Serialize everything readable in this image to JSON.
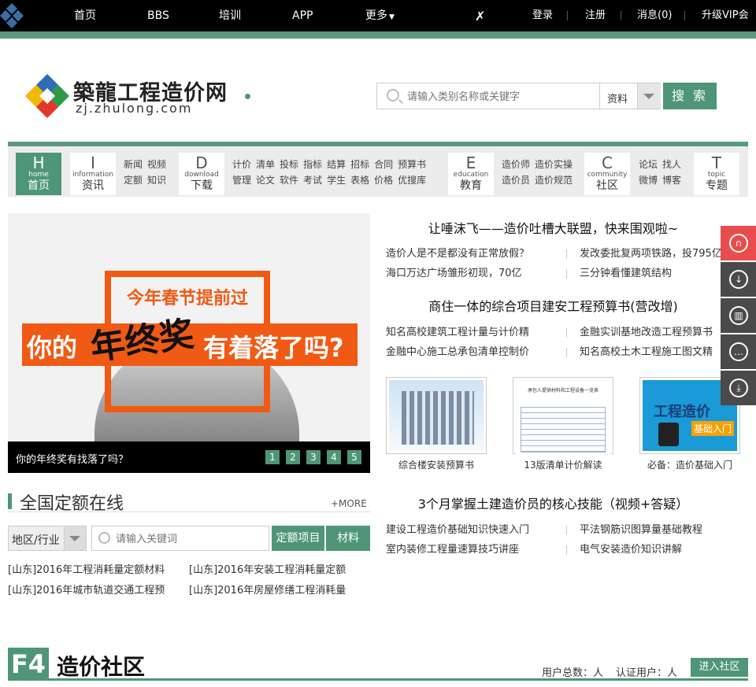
{
  "topnav": {
    "items": [
      "首页",
      "BBS",
      "培训",
      "APP",
      "更多"
    ],
    "right": [
      "登录",
      "注册",
      "消息(0)",
      "升级VIP会员"
    ]
  },
  "header": {
    "logo_cn": "築龍工程造价网",
    "logo_en": "zj.zhulong.com",
    "search_placeholder": "请输入类别名称或关键字",
    "search_type": "资料",
    "search_button": "搜 索"
  },
  "catnav": {
    "home": {
      "letter": "H",
      "en": "home",
      "zh": "首页"
    },
    "info": {
      "letter": "I",
      "en": "information",
      "zh": "资讯",
      "links": [
        [
          "新闻",
          "视频"
        ],
        [
          "定额",
          "知识"
        ]
      ]
    },
    "download": {
      "letter": "D",
      "en": "download",
      "zh": "下载",
      "links": [
        [
          "计价",
          "清单",
          "投标",
          "指标",
          "结算",
          "招标",
          "合同",
          "预算书"
        ],
        [
          "管理",
          "论文",
          "软件",
          "考试",
          "学生",
          "表格",
          "价格",
          "优搜库"
        ]
      ]
    },
    "education": {
      "letter": "E",
      "en": "education",
      "zh": "教育",
      "links": [
        [
          "造价师",
          "造价实操"
        ],
        [
          "造价员",
          "造价规范"
        ]
      ]
    },
    "community": {
      "letter": "C",
      "en": "community",
      "zh": "社区",
      "links": [
        [
          "论坛",
          "找人"
        ],
        [
          "微博",
          "博客"
        ]
      ]
    },
    "topic": {
      "letter": "T",
      "en": "topic",
      "zh": "专题"
    }
  },
  "slider": {
    "banner_top": "今年春节提前过",
    "banner_main_1": "你的",
    "banner_main_2": "年终奖",
    "banner_main_3": "有着落了吗?",
    "caption": "你的年终奖有找落了吗？",
    "pages": [
      "1",
      "2",
      "3",
      "4",
      "5"
    ]
  },
  "news": {
    "head1": "让唾沫飞——造价吐槽大联盟，快来围观啦~",
    "list1": [
      "造价人是不是都没有正常放假？",
      "发改委批复两项铁路，投795亿",
      "海口万达广场雏形初现，70亿",
      "三分钟看懂建筑结构"
    ],
    "head2": "商住一体的综合项目建安工程预算书(营改增)",
    "list2": [
      "知名高校建筑工程计量与计价精",
      "金融实训基地改造工程预算书",
      "金融中心施工总承包清单控制价",
      "知名高校土木工程施工图文精"
    ],
    "thumbs": [
      "综合楼安装预算书",
      "13版清单计价解读",
      "必备：造价基础入门"
    ],
    "thumb2_title": "承包人提供材料和工程设备一览表",
    "thumb3_title": "工程造价",
    "thumb3_sub": "基础入门",
    "head3": "3个月掌握土建造价员的核心技能（视频+答疑）",
    "list3": [
      "建设工程造价基础知识快速入门",
      "平法钢筋识图算量基础教程",
      "室内装修工程量速算技巧讲座",
      "电气安装造价知识讲解"
    ]
  },
  "quota": {
    "title": "全国定额在线",
    "more": "+MORE",
    "region": "地区/行业",
    "placeholder": "请输入关键词",
    "btn1": "定额项目",
    "btn2": "材料",
    "items": [
      "[山东]2016年工程消耗量定额材料",
      "[山东]2016年安装工程消耗量定额",
      "[山东]2016年城市轨道交通工程预",
      "[山东]2016年房屋修缮工程消耗量"
    ]
  },
  "community": {
    "floor": "F4",
    "title": "造价社区",
    "users": "用户总数：人",
    "certified": "认证用户：人",
    "enter": "进入社区"
  },
  "colors": {
    "accent": "#4e9676",
    "topbar": "#000000",
    "banner_orange": "#f05a14"
  }
}
